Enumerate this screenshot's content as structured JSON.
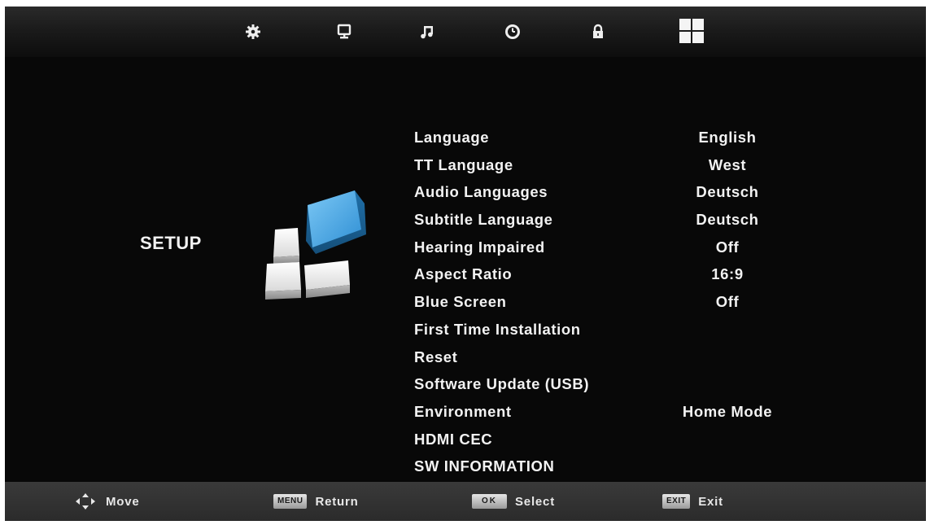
{
  "top_tabs": [
    {
      "icon": "gear-icon"
    },
    {
      "icon": "monitor-icon"
    },
    {
      "icon": "music-note-icon"
    },
    {
      "icon": "clock-icon"
    },
    {
      "icon": "lock-icon"
    },
    {
      "icon": "setup-grid-icon",
      "selected": true
    }
  ],
  "page_title": "SETUP",
  "menu_items": [
    {
      "label": "Language",
      "value": "English"
    },
    {
      "label": "TT Language",
      "value": "West"
    },
    {
      "label": "Audio Languages",
      "value": "Deutsch"
    },
    {
      "label": "Subtitle Language",
      "value": "Deutsch"
    },
    {
      "label": "Hearing Impaired",
      "value": "Off"
    },
    {
      "label": "Aspect Ratio",
      "value": "16:9"
    },
    {
      "label": "Blue Screen",
      "value": "Off"
    },
    {
      "label": "First Time Installation",
      "value": ""
    },
    {
      "label": "Reset",
      "value": ""
    },
    {
      "label": "Software Update (USB)",
      "value": ""
    },
    {
      "label": "Environment",
      "value": "Home Mode"
    },
    {
      "label": "HDMI CEC",
      "value": ""
    },
    {
      "label": "SW INFORMATION",
      "value": ""
    }
  ],
  "footer": {
    "move_label": "Move",
    "menu_key": "MENU",
    "return_label": "Return",
    "ok_key": "OK",
    "select_label": "Select",
    "exit_key": "EXIT",
    "exit_label": "Exit"
  },
  "colors": {
    "background": "#080808",
    "text": "#f2f2f2",
    "accent_blue": "#3a9de0"
  }
}
